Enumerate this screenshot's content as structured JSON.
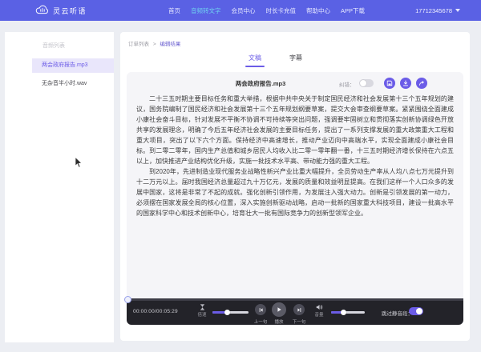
{
  "navbar": {
    "logo_text": "灵云听语",
    "items": [
      {
        "label": "首页",
        "active": false
      },
      {
        "label": "音频转文字",
        "active": true
      },
      {
        "label": "会员中心",
        "active": false
      },
      {
        "label": "时长卡充值",
        "active": false
      },
      {
        "label": "帮助中心",
        "active": false
      },
      {
        "label": "APP下载",
        "active": false
      }
    ],
    "account_phone": "17712345678"
  },
  "sidebar": {
    "title": "音频列表",
    "items": [
      {
        "label": "两会政府报告.mp3",
        "selected": true
      },
      {
        "label": "无杂音半小时.wav",
        "selected": false
      }
    ]
  },
  "breadcrumb": {
    "parent": "订单列表",
    "separator": ">",
    "current": "编辑结果"
  },
  "tabs": [
    {
      "label": "文稿",
      "active": true
    },
    {
      "label": "字幕",
      "active": false
    }
  ],
  "document": {
    "title": "两会政府报告.mp3",
    "correction_label": "纠错：",
    "correction_enabled": false,
    "action_icons": [
      "save-icon",
      "download-icon",
      "share-icon"
    ],
    "paragraphs": [
      "二十三五时期主要目标任务和重大举措，根据中共中央关于制定国民经济和社会发展第十三个五年规划的建议，国务院编制了国民经济和社会发展第十三个五年规划纲要草案，提交大会审查纲要草案。紧紧围绕全面建成小康社会奋斗目标，针对发展不平衡不协调不可持续等突出问题，强调要牢固树立和贯彻落实创新协调绿色开放共享的发展理念，明确了今后五年经济社会发展的主要目标任务，提出了一系列支撑发展的重大政策重大工程和重大项目，突出了以下六个方面。保持经济中高速增长，推动产业迈向中高端水平，实现全面建成小康社会目标。到二零二零年，国内生产总值和城乡居民人均收入比二零一零年翻一番，十三五时期经济增长保持在六点五以上，加快推进产业结构优化升级，实施一批技术水平高、带动能力强的重大工程。",
      "到2020年，先进制造业现代服务业战略性新兴产业比重大幅提升，全员劳动生产率从人均八点七万元提升到十二万元以上。届时我国经济总量超过九十万亿元，发展的质量和效益明显提高。在我们这样一个人口众多的发展中国家，这将是非常了不起的成就。强化创新引领作用，为发展注入强大动力。创新是引领发展的第一动力，必须摆在国家发展全局的核心位置，深入实施创新驱动战略，启动一批新的国家重大科技项目，建设一批高水平的国家科学中心和技术创新中心，培育壮大一批有国际竞争力的创新型领军企业。"
    ]
  },
  "player": {
    "time": "00:00:00/00:05:29",
    "progress_percent": 0,
    "speed": {
      "label": "倍速",
      "percent": 40
    },
    "controls": {
      "prev": "上一句",
      "play": "播放",
      "next": "下一句"
    },
    "volume": {
      "label": "音量",
      "percent": 38
    },
    "skip_silence": {
      "label": "跳过静音段：",
      "enabled": true
    }
  },
  "colors": {
    "navbar_bg": "#5a61e4",
    "nav_active_text": "#6fd2f1",
    "accent_purple": "#6b5ce7",
    "sidebar_selected_bg": "#e9e6fb",
    "panel_bg": "#f5f5f8",
    "player_bg": "#232329"
  }
}
